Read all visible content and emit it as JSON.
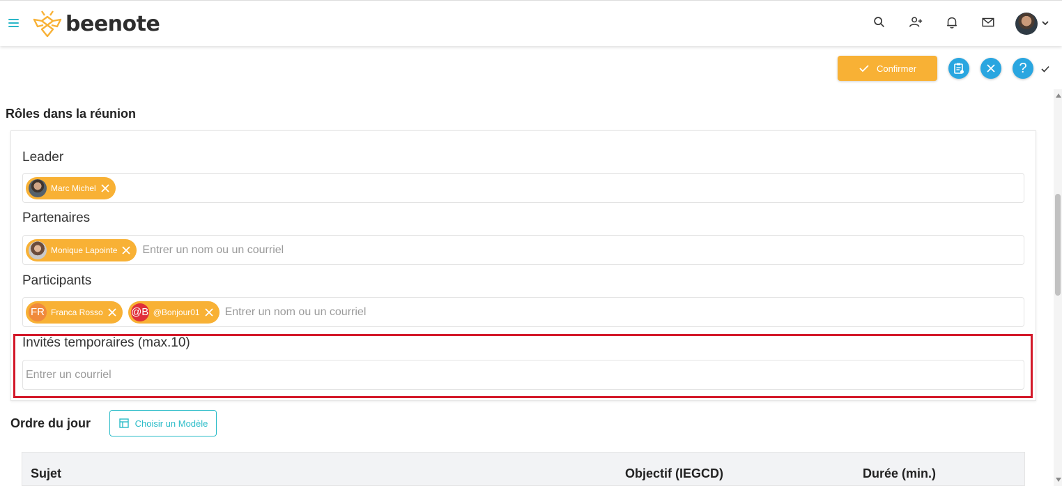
{
  "header": {
    "logo_text": "beenote",
    "icons": [
      "menu-icon",
      "search-icon",
      "add-user-icon",
      "bell-icon",
      "mail-icon",
      "avatar",
      "chevron-down-icon"
    ]
  },
  "actions": {
    "confirm_label": "Confirmer",
    "help_label": "?"
  },
  "roles": {
    "title": "Rôles dans la réunion",
    "leader": {
      "label": "Leader",
      "chips": [
        {
          "name": "Marc Michel"
        }
      ]
    },
    "partners": {
      "label": "Partenaires",
      "chips": [
        {
          "name": "Monique Lapointe"
        }
      ],
      "placeholder": "Entrer un nom ou un courriel"
    },
    "participants": {
      "label": "Participants",
      "chips": [
        {
          "initials": "FR",
          "name": "Franca Rosso"
        },
        {
          "initials": "@B",
          "name": "@Bonjour01"
        }
      ],
      "placeholder": "Entrer un nom ou un courriel"
    },
    "guests": {
      "label": "Invités temporaires (max.10)",
      "placeholder": "Entrer un courriel"
    }
  },
  "agenda": {
    "title": "Ordre du jour",
    "template_button": "Choisir un Modèle",
    "columns": [
      "Sujet",
      "Objectif (IEGCD)",
      "Durée (min.)"
    ]
  },
  "colors": {
    "accent": "#f8b135",
    "teal": "#2bbcc8",
    "blue": "#2aa6e0",
    "highlight": "#d3192a"
  }
}
